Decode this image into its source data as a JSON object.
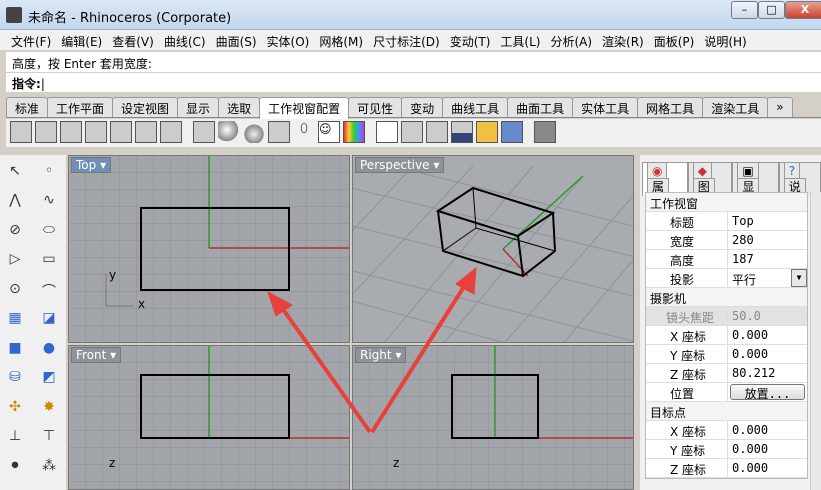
{
  "window": {
    "title": "未命名 - Rhinoceros (Corporate)",
    "min": "–",
    "max": "□",
    "close": "X"
  },
  "menu": [
    "文件(F)",
    "编辑(E)",
    "查看(V)",
    "曲线(C)",
    "曲面(S)",
    "实体(O)",
    "网格(M)",
    "尺寸标注(D)",
    "变动(T)",
    "工具(L)",
    "分析(A)",
    "渲染(R)",
    "面板(P)",
    "说明(H)"
  ],
  "command": {
    "history": "高度，按 Enter 套用宽度:",
    "prompt": "指令:"
  },
  "tabs": [
    "标准",
    "工作平面",
    "设定视图",
    "显示",
    "选取",
    "工作视窗配置",
    "可见性",
    "变动",
    "曲线工具",
    "曲面工具",
    "实体工具",
    "网格工具",
    "渲染工具",
    "»"
  ],
  "active_tab": "工作视窗配置",
  "viewports": {
    "top": "Top",
    "perspective": "Perspective",
    "front": "Front",
    "right": "Right"
  },
  "axes": {
    "x": "x",
    "y": "y",
    "z": "z"
  },
  "panel": {
    "tabs": [
      "属",
      "图",
      "显",
      "说"
    ],
    "sections": {
      "viewport": "工作视窗",
      "camera": "摄影机",
      "target": "目标点"
    },
    "viewport_rows": [
      {
        "k": "标题",
        "v": "Top"
      },
      {
        "k": "宽度",
        "v": "280"
      },
      {
        "k": "高度",
        "v": "187"
      },
      {
        "k": "投影",
        "v": "平行"
      }
    ],
    "camera_rows": [
      {
        "k": "镜头焦距",
        "v": "50.0"
      },
      {
        "k": "X 座标",
        "v": "0.000"
      },
      {
        "k": "Y 座标",
        "v": "0.000"
      },
      {
        "k": "Z 座标",
        "v": "80.212"
      },
      {
        "k": "位置",
        "v": "放置..."
      }
    ],
    "target_rows": [
      {
        "k": "X 座标",
        "v": "0.000"
      },
      {
        "k": "Y 座标",
        "v": "0.000"
      },
      {
        "k": "Z 座标",
        "v": "0.000"
      }
    ]
  },
  "colors": {
    "arrow": "#e8403a",
    "xaxis": "#c03030",
    "yaxis": "#30a030"
  }
}
